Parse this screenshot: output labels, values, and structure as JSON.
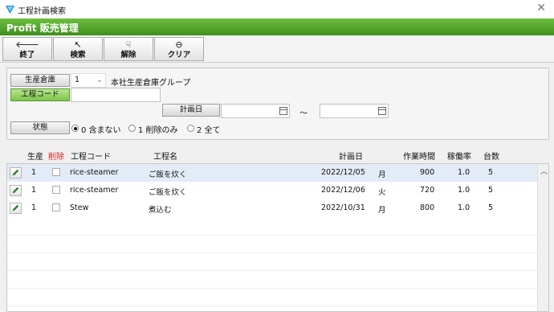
{
  "window": {
    "title": "工程計画検索",
    "close_glyph": "✕"
  },
  "banner": {
    "brand": "Profit 販売管理",
    "accent": "#5aa82e"
  },
  "toolbar": {
    "buttons": [
      {
        "icon": "arrow-left-icon",
        "glyph": "🡐",
        "label": "終了"
      },
      {
        "icon": "cursor-icon",
        "glyph": "↖",
        "label": "検索"
      },
      {
        "icon": "pointer-icon",
        "glyph": "☟",
        "label": "解除"
      },
      {
        "icon": "minus-circle-icon",
        "glyph": "⊖",
        "label": "クリア"
      }
    ]
  },
  "search": {
    "warehouse_label": "生産倉庫",
    "warehouse_code": "1",
    "warehouse_name": "本社生産倉庫グループ",
    "process_code_label": "工程コード",
    "process_code_value": "",
    "plan_date_label": "計画日",
    "plan_date_from": "",
    "plan_date_to": "",
    "range_sep": "～",
    "status_label": "状態",
    "status_options": [
      "0 含まない",
      "1 削除のみ",
      "2 全て"
    ],
    "status_selected": 0
  },
  "table": {
    "columns": [
      "生産",
      "削除",
      "工程コード",
      "工程名",
      "計画日",
      "作業時間",
      "稼働率",
      "台数"
    ],
    "rows": [
      {
        "prod": "1",
        "code": "rice-steamer",
        "name": "ご飯を炊く",
        "date": "2022/12/05",
        "dow": "月",
        "hours": "900",
        "rate": "1.0",
        "units": "5"
      },
      {
        "prod": "1",
        "code": "rice-steamer",
        "name": "ご飯を炊く",
        "date": "2022/12/06",
        "dow": "火",
        "hours": "720",
        "rate": "1.0",
        "units": "5"
      },
      {
        "prod": "1",
        "code": "Stew",
        "name": "煮込む",
        "date": "2022/10/31",
        "dow": "月",
        "hours": "800",
        "rate": "1.0",
        "units": "5"
      }
    ],
    "delete_color": "#e02020"
  }
}
